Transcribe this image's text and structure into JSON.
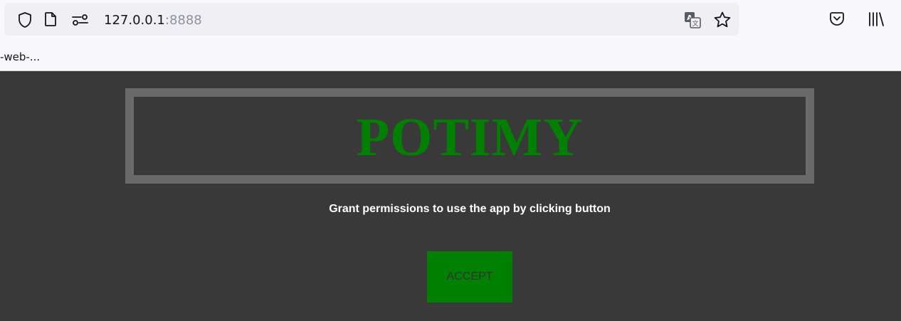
{
  "browser": {
    "url_host": "127.0.0.1",
    "url_port": ":8888",
    "bookmark_label": "-web-..."
  },
  "icons": {
    "shield": "shield-icon",
    "page": "page-icon",
    "permissions": "permissions-icon",
    "translate": "translate-icon",
    "star": "star-icon",
    "pocket": "pocket-icon",
    "library": "library-icon"
  },
  "app": {
    "logo": "POTIMY",
    "instructions": "Grant permissions to use the app by clicking button",
    "accept_label": "ACCEPT"
  },
  "colors": {
    "background": "#393939",
    "logo_green": "#008000",
    "frame_gray": "#6a6a6a",
    "button_green": "#008000"
  }
}
